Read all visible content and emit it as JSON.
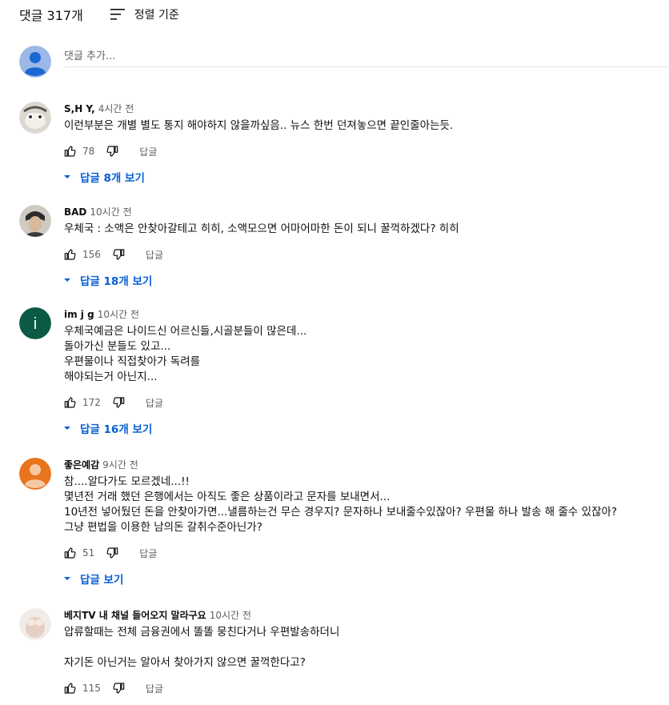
{
  "header": {
    "count_label": "댓글 317개",
    "sort_label": "정렬 기준"
  },
  "add_comment": {
    "placeholder": "댓글 추가..."
  },
  "comments": [
    {
      "author": "S,H Y,",
      "time": "4시간 전",
      "lines": [
        "이런부분은 개별 별도 통지 해야하지 않을까싶음.. 뉴스 한번 던져놓으면 끝인줄아는듯."
      ],
      "likes": "78",
      "reply_label": "답글",
      "replies_label": "답글 8개 보기"
    },
    {
      "author": "BAD",
      "time": "10시간 전",
      "lines": [
        "우체국 : 소액은 안찾아갈테고 히히, 소액모으면 어마어마한 돈이 되니 꿀꺽하겠다? 히히"
      ],
      "likes": "156",
      "reply_label": "답글",
      "replies_label": "답글 18개 보기"
    },
    {
      "author": "im j g",
      "time": "10시간 전",
      "avatar_letter": "i",
      "lines": [
        "우체국예금은 나이드신 어르신들,시골분들이 많은데...",
        "돌아가신 분들도 있고...",
        "우편물이나 직접찾아가 독려를",
        "해야되는거 아닌지..."
      ],
      "likes": "172",
      "reply_label": "답글",
      "replies_label": "답글 16개 보기"
    },
    {
      "author": "좋은예감",
      "time": "9시간 전",
      "lines": [
        "참....알다가도 모르겠네...!!",
        "몇년전 거래 했던 은행에서는 아직도 좋은 상품이라고 문자를 보내면서...",
        "10년전 넣어뒀던 돈을 안찾아가면...낼름하는건 무슨 경우지? 문자하나 보내줄수있잖아? 우편물 하나 발송 해 줄수 있잖아?",
        "그냥 편법을 이용한 남의돈 갈취수준아닌가?"
      ],
      "likes": "51",
      "reply_label": "답글",
      "replies_label": "답글 보기"
    },
    {
      "author": "베지TV 내 채널 들어오지 말라구요",
      "time": "10시간 전",
      "lines": [
        "압류할때는 전체 금융권에서 똘똘 뭉친다거나 우편발송하더니",
        "",
        "자기돈 아닌거는 알아서 찾아가지 않으면 꿀꺽한다고?"
      ],
      "likes": "115",
      "reply_label": "답글"
    }
  ],
  "colors": {
    "link_blue": "#065fd4",
    "meta_gray": "#606060",
    "avatar_green": "#0b5a45",
    "avatar_orange": "#e8741c",
    "avatar_default": "#9bb8e6"
  }
}
